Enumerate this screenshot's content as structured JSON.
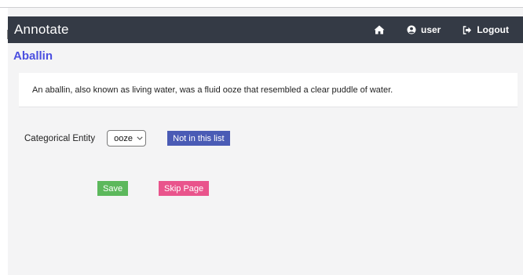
{
  "navbar": {
    "brand": "Annotate",
    "user_label": "user",
    "logout_label": "Logout"
  },
  "page": {
    "title": "Aballin",
    "description": "An aballin, also known as living water, was a fluid ooze that resembled a clear puddle of water."
  },
  "form": {
    "entity_label": "Categorical Entity",
    "entity_selected": "ooze",
    "not_in_list_label": "Not in this list",
    "save_label": "Save",
    "skip_label": "Skip Page"
  },
  "colors": {
    "navbar_bg": "#343a45",
    "title": "#4b4fe0",
    "primary_button": "#4a5bb5",
    "save_button": "#5cb85c",
    "skip_button": "#e9548c"
  },
  "icons": {
    "home": "home-icon",
    "user": "user-circle-icon",
    "logout": "sign-out-icon",
    "dropdown": "chevron-down-icon"
  }
}
